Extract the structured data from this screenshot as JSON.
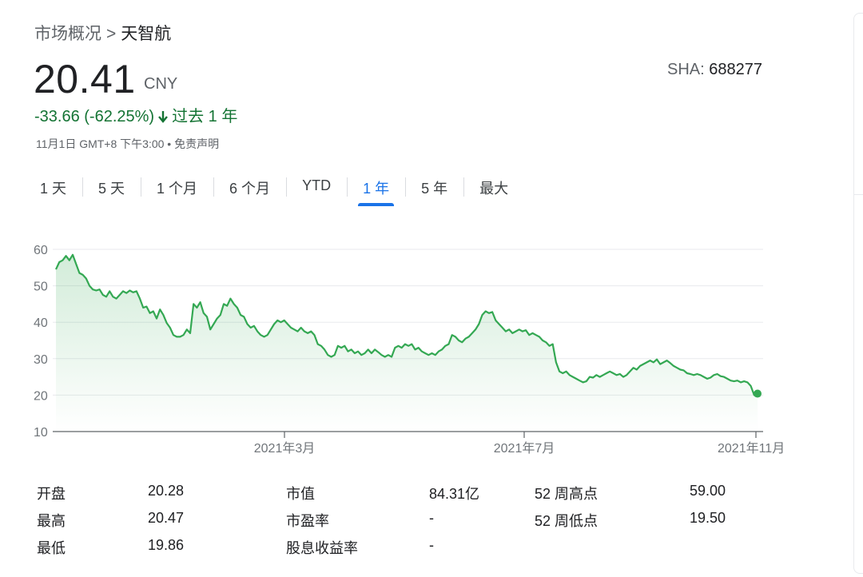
{
  "breadcrumb": {
    "parent": "市场概况",
    "separator": ">",
    "current": "天智航"
  },
  "quote": {
    "price": "20.41",
    "currency": "CNY",
    "exchange_label": "SHA:",
    "exchange_code": "688277",
    "change_text": "-33.66 (-62.25%)",
    "change_period": "过去 1 年",
    "timestamp": "11月1日 GMT+8 下午3:00 • 免责声明"
  },
  "tabs": [
    {
      "label": "1 天"
    },
    {
      "label": "5 天"
    },
    {
      "label": "1 个月"
    },
    {
      "label": "6 个月"
    },
    {
      "label": "YTD"
    },
    {
      "label": "1 年",
      "active": true
    },
    {
      "label": "5 年"
    },
    {
      "label": "最大"
    }
  ],
  "colors": {
    "line": "#34a853",
    "accent": "#1a73e8",
    "negative": "#137333"
  },
  "chart_data": {
    "type": "area",
    "y_ticks": [
      10,
      20,
      30,
      40,
      50,
      60
    ],
    "ylim": [
      10,
      60
    ],
    "x_ticks": [
      "2021年3月",
      "2021年7月",
      "2021年11月"
    ],
    "series": [
      {
        "values": [
          54.5,
          56.5,
          57.0,
          58.2,
          57.0,
          58.5,
          56.0,
          53.5,
          53.0,
          52.0,
          50.0,
          49.0,
          48.7,
          49.0,
          47.5,
          47.0,
          48.5,
          47.0,
          46.5,
          47.5,
          48.5,
          48.0,
          48.7,
          48.2,
          48.5,
          46.5,
          44.0,
          44.3,
          42.5,
          43.0,
          41.0,
          43.5,
          42.0,
          39.8,
          38.5,
          36.5,
          36.0,
          36.0,
          36.5,
          38.0,
          37.0,
          45.0,
          44.0,
          45.5,
          42.5,
          41.5,
          38.0,
          39.5,
          41.0,
          42.0,
          45.0,
          44.5,
          46.5,
          45.0,
          44.0,
          42.0,
          41.5,
          39.5,
          38.5,
          39.0,
          37.5,
          36.5,
          36.0,
          36.5,
          38.0,
          39.5,
          40.5,
          40.0,
          40.5,
          39.5,
          38.5,
          38.0,
          37.5,
          38.5,
          37.5,
          37.0,
          37.5,
          36.5,
          34.0,
          33.5,
          32.5,
          31.0,
          30.5,
          31.0,
          33.5,
          33.0,
          33.5,
          32.0,
          32.5,
          31.5,
          32.0,
          31.0,
          31.5,
          32.5,
          31.5,
          32.5,
          31.8,
          31.0,
          30.5,
          31.0,
          30.5,
          33.0,
          33.5,
          33.0,
          34.0,
          33.5,
          34.0,
          32.5,
          33.0,
          32.0,
          31.5,
          31.0,
          31.5,
          31.0,
          32.0,
          32.5,
          33.5,
          34.0,
          36.5,
          36.0,
          35.0,
          34.5,
          35.5,
          36.0,
          37.0,
          38.0,
          39.5,
          42.0,
          43.0,
          42.5,
          42.8,
          40.5,
          39.5,
          38.5,
          37.5,
          38.0,
          37.0,
          37.5,
          38.0,
          37.5,
          37.8,
          36.5,
          37.0,
          36.5,
          36.0,
          35.0,
          34.5,
          33.5,
          34.0,
          29.0,
          26.5,
          26.0,
          26.5,
          25.5,
          25.0,
          24.5,
          24.0,
          23.5,
          23.8,
          25.0,
          24.8,
          25.5,
          25.0,
          25.5,
          26.0,
          26.5,
          26.0,
          25.5,
          25.8,
          25.0,
          25.5,
          26.5,
          27.5,
          27.0,
          28.0,
          28.5,
          29.0,
          29.5,
          29.0,
          29.8,
          28.5,
          29.0,
          29.5,
          28.8,
          28.0,
          27.5,
          27.0,
          26.8,
          26.0,
          25.8,
          25.5,
          25.8,
          25.5,
          25.0,
          24.5,
          24.8,
          25.5,
          25.8,
          25.2,
          25.0,
          24.5,
          24.0,
          23.8,
          24.0,
          23.5,
          23.8,
          23.5,
          22.5,
          20.0,
          20.41
        ]
      }
    ],
    "grid": true
  },
  "stats": [
    {
      "label": "开盘",
      "value": "20.28"
    },
    {
      "label": "最高",
      "value": "20.47"
    },
    {
      "label": "最低",
      "value": "19.86"
    },
    {
      "label": "市值",
      "value": "84.31亿"
    },
    {
      "label": "市盈率",
      "value": "-"
    },
    {
      "label": "股息收益率",
      "value": "-"
    },
    {
      "label": "52 周高点",
      "value": "59.00"
    },
    {
      "label": "52 周低点",
      "value": "19.50"
    }
  ]
}
